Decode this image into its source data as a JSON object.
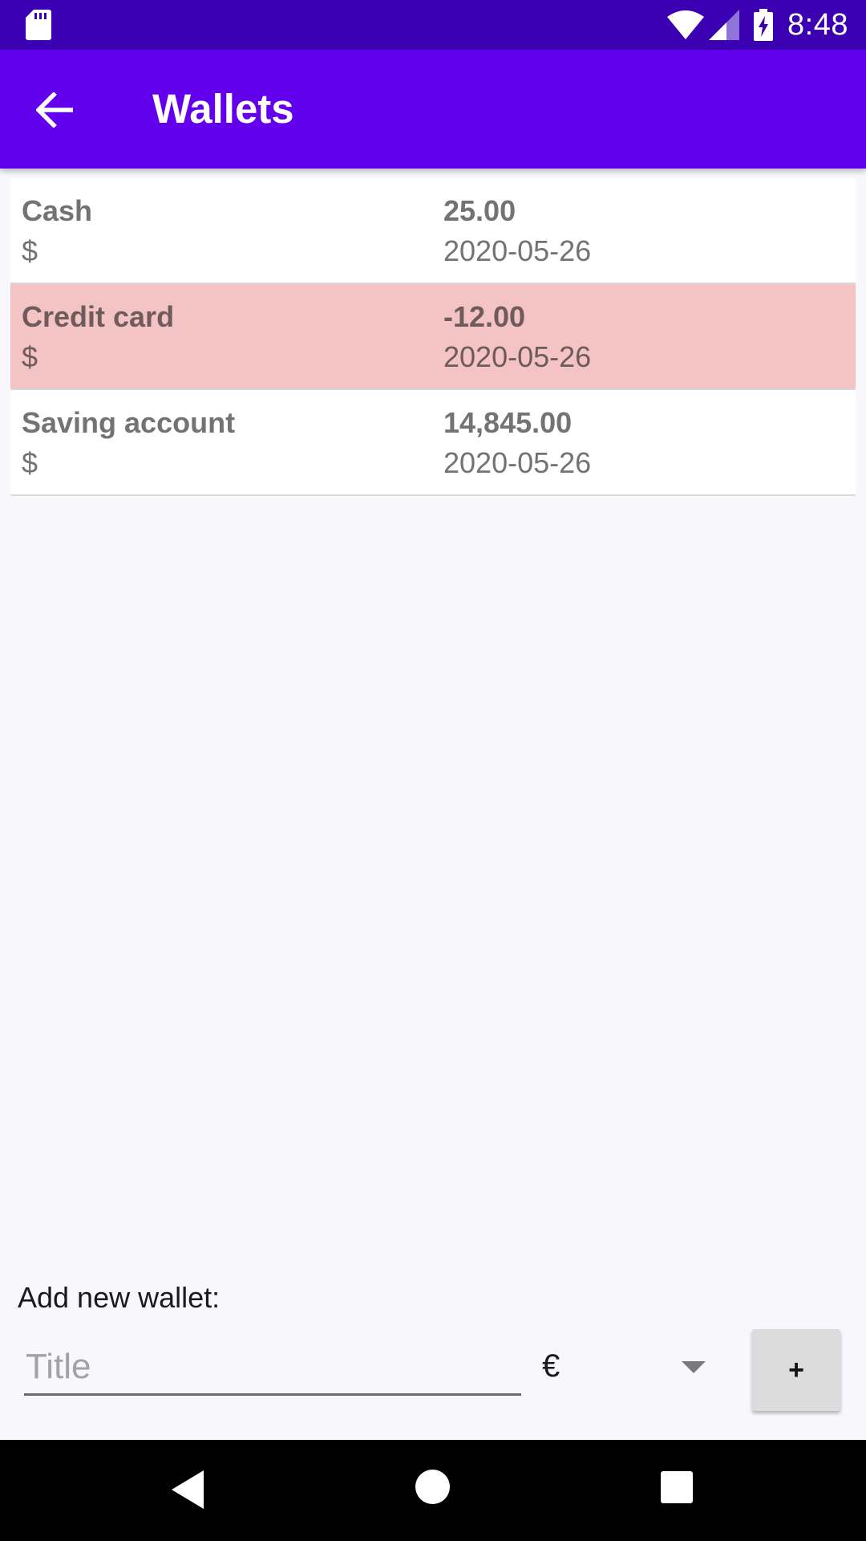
{
  "status_bar": {
    "time": "8:48",
    "icons": [
      "sd-card-icon",
      "wifi-icon",
      "signal-icon",
      "battery-charging-icon"
    ]
  },
  "app_bar": {
    "title": "Wallets",
    "back_icon": "arrow-left-icon"
  },
  "wallets": [
    {
      "name": "Cash",
      "currency": "$",
      "balance": "25.00",
      "date": "2020-05-26",
      "negative": false
    },
    {
      "name": "Credit card",
      "currency": "$",
      "balance": "-12.00",
      "date": "2020-05-26",
      "negative": true
    },
    {
      "name": "Saving account",
      "currency": "$",
      "balance": "14,845.00",
      "date": "2020-05-26",
      "negative": false
    }
  ],
  "add_wallet": {
    "label": "Add new wallet:",
    "title_placeholder": "Title",
    "title_value": "",
    "currency_selected": "€",
    "add_button_label": "+"
  },
  "colors": {
    "status_bar": "#3a00b2",
    "app_bar": "#6200ee",
    "negative_row": "#f4c4c4",
    "background": "#f8f7fb"
  },
  "nav_bar": {
    "icons": [
      "nav-back-icon",
      "nav-home-icon",
      "nav-recents-icon"
    ]
  }
}
